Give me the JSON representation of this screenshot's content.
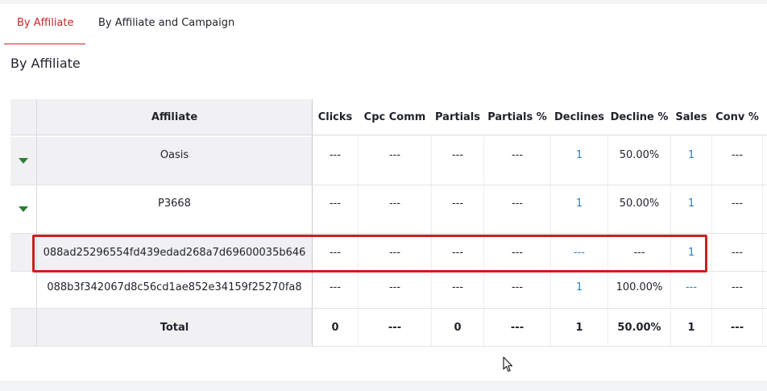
{
  "tabs": [
    {
      "label": "By Affiliate",
      "active": true
    },
    {
      "label": "By Affiliate and Campaign",
      "active": false
    }
  ],
  "section_title": "By Affiliate",
  "columns": [
    "Affiliate",
    "Clicks",
    "Cpc Comm",
    "Partials",
    "Partials %",
    "Declines",
    "Decline %",
    "Sales",
    "Conv %"
  ],
  "rows": [
    {
      "affiliate": "Oasis",
      "clicks": "---",
      "cpc_comm": "---",
      "partials": "---",
      "partials_pct": "---",
      "declines": "1",
      "decline_pct": "50.00%",
      "sales": "1",
      "conv_pct": "---"
    },
    {
      "affiliate": "P3668",
      "clicks": "---",
      "cpc_comm": "---",
      "partials": "---",
      "partials_pct": "---",
      "declines": "1",
      "decline_pct": "50.00%",
      "sales": "1",
      "conv_pct": "---"
    },
    {
      "affiliate": "088ad25296554fd439edad268a7d69600035b646",
      "clicks": "---",
      "cpc_comm": "---",
      "partials": "---",
      "partials_pct": "---",
      "declines": "---",
      "decline_pct": "---",
      "sales": "1",
      "conv_pct": "---"
    },
    {
      "affiliate": "088b3f342067d8c56cd1ae852e34159f25270fa8",
      "clicks": "---",
      "cpc_comm": "---",
      "partials": "---",
      "partials_pct": "---",
      "declines": "1",
      "decline_pct": "100.00%",
      "sales": "---",
      "conv_pct": "---"
    }
  ],
  "total": {
    "label": "Total",
    "clicks": "0",
    "cpc_comm": "---",
    "partials": "0",
    "partials_pct": "---",
    "declines": "1",
    "decline_pct": "50.00%",
    "sales": "1",
    "conv_pct": "---"
  },
  "colors": {
    "accent": "#c62828",
    "link": "#2f7fc0",
    "expand": "#2e7d32",
    "highlight": "#c91f1f"
  }
}
